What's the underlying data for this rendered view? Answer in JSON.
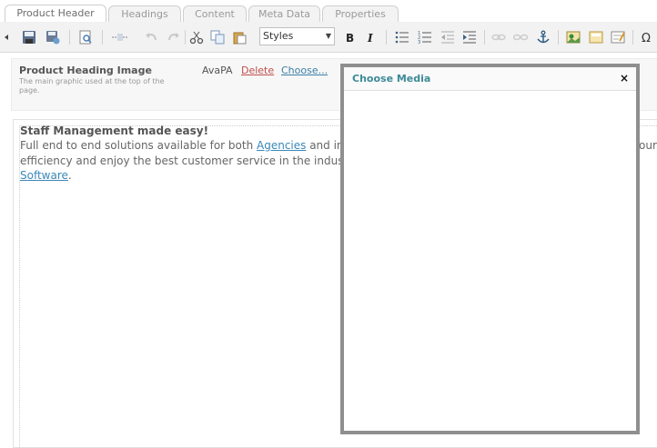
{
  "tabs": [
    {
      "label": "Product Header",
      "active": true
    },
    {
      "label": "Headings",
      "active": false
    },
    {
      "label": "Content",
      "active": false
    },
    {
      "label": "Meta Data",
      "active": false
    },
    {
      "label": "Properties",
      "active": false
    }
  ],
  "toolbar": {
    "styles_value": "Styles",
    "icons": [
      "collapse-arrow-icon",
      "save-icon",
      "save-as-icon",
      "preview-icon",
      "page-break-icon",
      "undo-icon",
      "redo-icon",
      "cut-icon",
      "copy-icon",
      "paste-icon",
      "bold-icon",
      "italic-icon",
      "bulleted-list-icon",
      "numbered-list-icon",
      "outdent-icon",
      "indent-icon",
      "link-icon",
      "unlink-icon",
      "anchor-icon",
      "image-icon",
      "media-icon",
      "form-icon",
      "special-char-icon"
    ]
  },
  "field": {
    "label": "Product Heading Image",
    "description": "The main graphic used at the top of the page.",
    "value": "AvaPA",
    "delete_label": "Delete",
    "choose_label": "Choose..."
  },
  "document": {
    "heading": "Staff Management made easy!",
    "line1_text": "Full end to end solutions available for both ",
    "line1_link": "Agencies",
    "line1_tail": " and in h",
    "line1_right": "our",
    "line2": "efficiency and enjoy the best customer service in the indust",
    "line3_link": "Software",
    "line3_tail": "."
  },
  "modal": {
    "title": "Choose Media",
    "close_label": "×"
  },
  "colors": {
    "link": "#3b88b8",
    "delete": "#c0504d",
    "modal_title": "#3d8a97",
    "modal_border": "#8f8f8f"
  }
}
